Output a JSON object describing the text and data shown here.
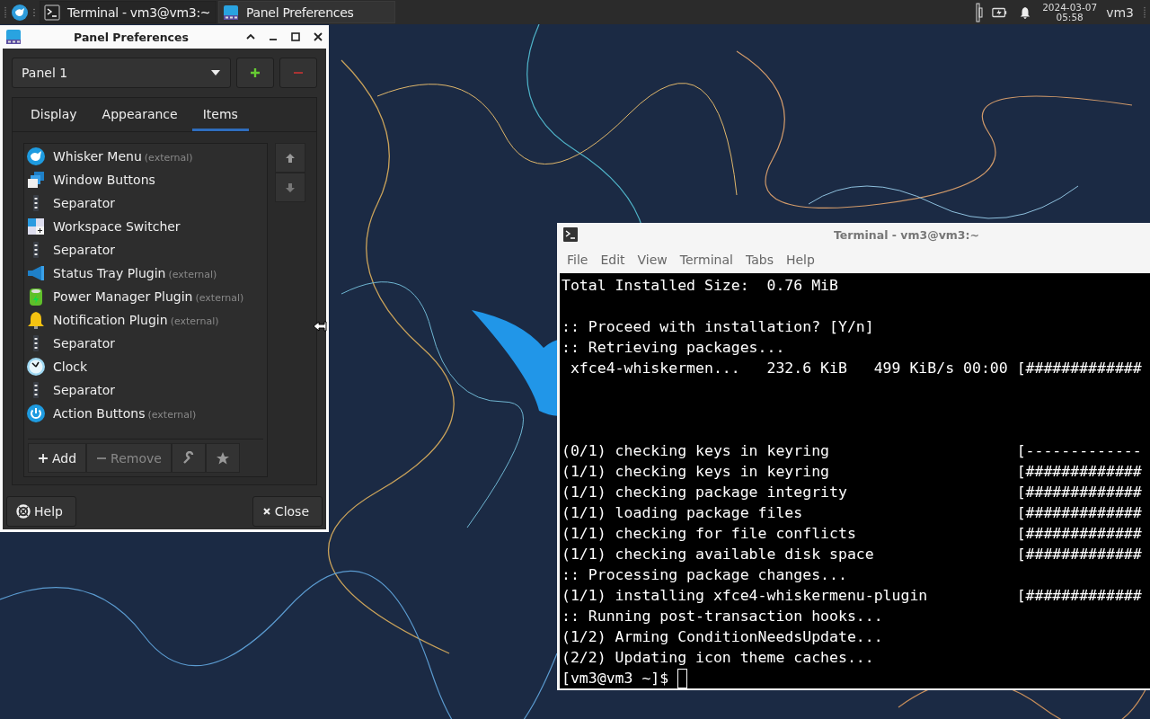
{
  "top_panel": {
    "tasks": [
      {
        "label": "Terminal - vm3@vm3:~",
        "kind": "terminal",
        "selected": false
      },
      {
        "label": "Panel Preferences",
        "kind": "panel",
        "selected": true
      }
    ],
    "date": "2024-03-07",
    "time": "05:58",
    "user": "vm3"
  },
  "preferences_window": {
    "title": "Panel Preferences",
    "panel_select": "Panel 1",
    "tabs": [
      {
        "label": "Display",
        "selected": false
      },
      {
        "label": "Appearance",
        "selected": false
      },
      {
        "label": "Items",
        "selected": true
      }
    ],
    "items": [
      {
        "name": "Whisker Menu",
        "note": "(external)",
        "kind": "whisker"
      },
      {
        "name": "Window Buttons",
        "kind": "windows"
      },
      {
        "name": "Separator",
        "kind": "separator"
      },
      {
        "name": "Workspace Switcher",
        "kind": "workspace"
      },
      {
        "name": "Separator",
        "kind": "separator"
      },
      {
        "name": "Status Tray Plugin",
        "note": "(external)",
        "kind": "tray"
      },
      {
        "name": "Power Manager Plugin",
        "note": "(external)",
        "kind": "power"
      },
      {
        "name": "Notification Plugin",
        "note": "(external)",
        "kind": "bell"
      },
      {
        "name": "Separator",
        "kind": "separator"
      },
      {
        "name": "Clock",
        "kind": "clock"
      },
      {
        "name": "Separator",
        "kind": "separator"
      },
      {
        "name": "Action Buttons",
        "note": "(external)",
        "kind": "action"
      }
    ],
    "add_label": "Add",
    "remove_label": "Remove",
    "remove_disabled": true,
    "help_label": "Help",
    "close_label": "Close"
  },
  "terminal_window": {
    "title": "Terminal - vm3@vm3:~",
    "menu": [
      "File",
      "Edit",
      "View",
      "Terminal",
      "Tabs",
      "Help"
    ],
    "blocks": [
      [
        "Total Installed Size:  0.76 MiB"
      ],
      [
        ":: Proceed with installation? [Y/n]",
        ":: Retrieving packages...",
        " xfce4-whiskermen...   232.6 KiB   499 KiB/s 00:00 [#############"
      ],
      [
        "(0/1) checking keys in keyring                     [-------------",
        "(1/1) checking keys in keyring                     [#############",
        "(1/1) checking package integrity                   [#############",
        "(1/1) loading package files                        [#############",
        "(1/1) checking for file conflicts                  [#############",
        "(1/1) checking available disk space                [#############",
        ":: Processing package changes...",
        "(1/1) installing xfce4-whiskermenu-plugin          [#############",
        ":: Running post-transaction hooks...",
        "(1/2) Arming ConditionNeedsUpdate...",
        "(2/2) Updating icon theme caches..."
      ]
    ],
    "prompt": "[vm3@vm3 ~]$ "
  }
}
